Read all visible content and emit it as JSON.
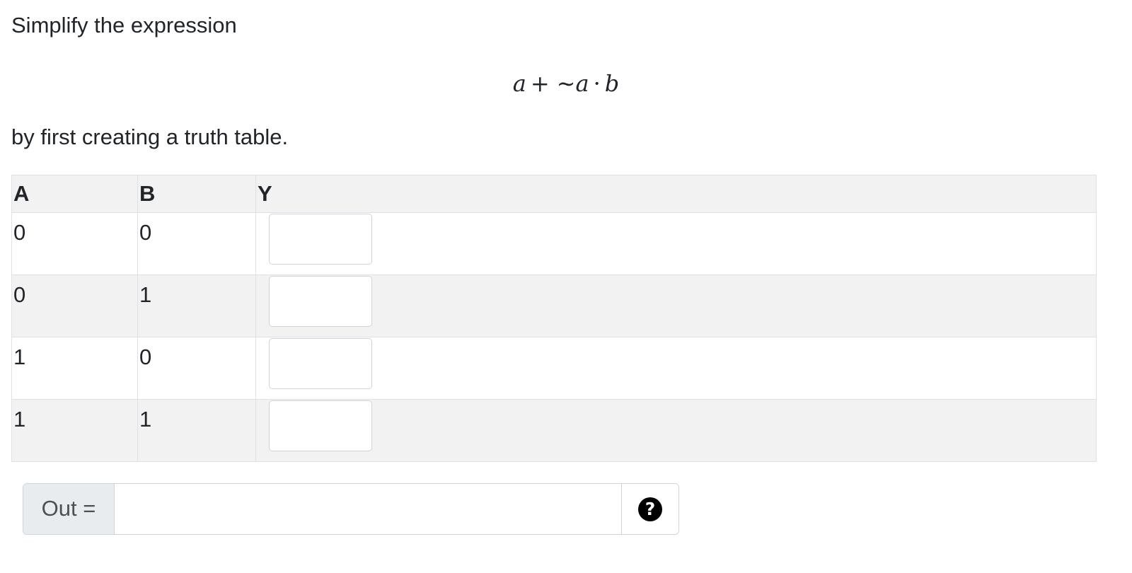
{
  "question": {
    "intro": "Simplify the expression",
    "formula": {
      "a1": "a",
      "plus": "+",
      "tilde": "∼",
      "a2": "a",
      "dot": "·",
      "b": "b"
    },
    "outro": "by first creating a truth table."
  },
  "truth_table": {
    "headers": [
      "A",
      "B",
      "Y"
    ],
    "rows": [
      {
        "a": "0",
        "b": "0",
        "y": ""
      },
      {
        "a": "0",
        "b": "1",
        "y": ""
      },
      {
        "a": "1",
        "b": "0",
        "y": ""
      },
      {
        "a": "1",
        "b": "1",
        "y": ""
      }
    ]
  },
  "answer": {
    "label": "Out =",
    "value": "",
    "help_icon": "question-circle-icon",
    "help_glyph": "?"
  },
  "colors": {
    "header_bg": "#f2f2f2",
    "stripe_bg": "#f2f2f2",
    "border": "#dee2e6",
    "input_border": "#ced4da",
    "addon_bg": "#e9ecef"
  }
}
